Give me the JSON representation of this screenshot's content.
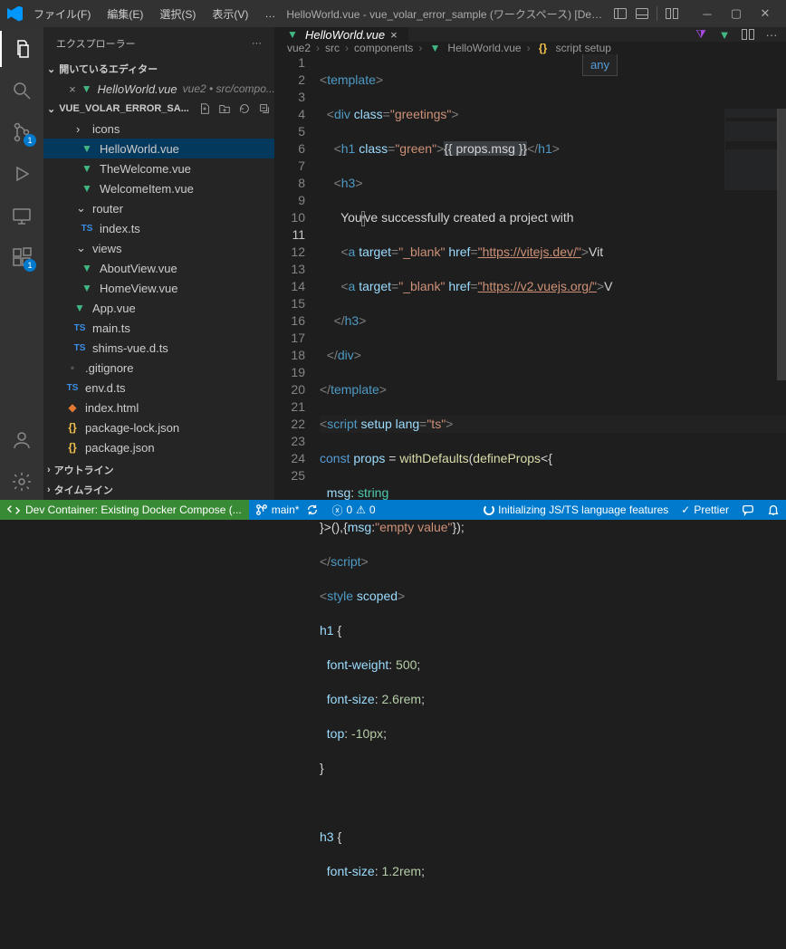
{
  "menu": {
    "file": "ファイル(F)",
    "edit": "編集(E)",
    "select": "選択(S)",
    "view": "表示(V)",
    "ellipsis": "…"
  },
  "window_title": "HelloWorld.vue - vue_volar_error_sample (ワークスペース) [Dev ...",
  "activity_badges": {
    "scm": "1",
    "ext": "1"
  },
  "sidebar": {
    "title": "エクスプローラー",
    "open_editors": "開いているエディター",
    "open_editor_file": "HelloWorld.vue",
    "open_editor_path": "vue2 • src/compo...",
    "workspace": "VUE_VOLAR_ERROR_SA...",
    "tree": {
      "icons": "icons",
      "hello": "HelloWorld.vue",
      "thewelcome": "TheWelcome.vue",
      "welcomeitem": "WelcomeItem.vue",
      "router": "router",
      "index_ts": "index.ts",
      "views": "views",
      "aboutview": "AboutView.vue",
      "homeview": "HomeView.vue",
      "app": "App.vue",
      "main_ts": "main.ts",
      "shims": "shims-vue.d.ts",
      "gitignore": ".gitignore",
      "envdts": "env.d.ts",
      "indexhtml": "index.html",
      "pkglock": "package-lock.json",
      "pkg": "package.json"
    },
    "outline": "アウトライン",
    "timeline": "タイムライン"
  },
  "editor": {
    "tab_label": "HelloWorld.vue",
    "breadcrumb": [
      "vue2",
      "src",
      "components",
      "HelloWorld.vue",
      "script setup"
    ],
    "hover_tip": "any"
  },
  "code_lines": {
    "l1": "template",
    "l2_attr": "class",
    "l2_val": "\"greetings\"",
    "l3_attr": "class",
    "l3_val": "\"green\"",
    "l3_expr": "{{ props.msg }}",
    "l5_text_a": "You",
    "l5_text_b": "ve successfully created a project with",
    "l6_target": "\"_blank\"",
    "l6_href": "\"https://vitejs.dev/\"",
    "l6_text": "Vit",
    "l7_target": "\"_blank\"",
    "l7_href": "\"https://v2.vuejs.org/\"",
    "l7_text": "V",
    "l11_lang": "\"ts\"",
    "l12_a": "props",
    "l12_b": "withDefaults",
    "l12_c": "defineProps",
    "l13_a": "msg",
    "l13_b": "string",
    "l14_a": "msg",
    "l14_b": "\"empty value\"",
    "l16_scoped": "scoped",
    "l18": "font-weight",
    "l18v": "500",
    "l19": "font-size",
    "l19v": "2.6rem",
    "l20": "top",
    "l20v": "-10px",
    "l24": "font-size",
    "l24v": "1.2rem"
  },
  "status": {
    "remote": "Dev Container: Existing Docker Compose (...",
    "branch": "main*",
    "errors": "0",
    "warnings": "0",
    "loading": "Initializing JS/TS language features",
    "prettier": "Prettier"
  }
}
